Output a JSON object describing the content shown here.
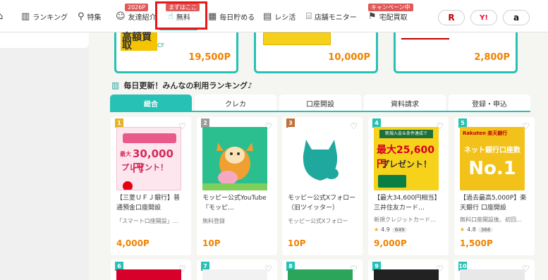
{
  "nav": {
    "items": [
      {
        "label": "ランキング",
        "icon": "ranking-icon"
      },
      {
        "label": "特集",
        "icon": "pin-icon"
      },
      {
        "label": "友達紹介",
        "icon": "friends-icon",
        "badge": "2026P"
      },
      {
        "label": "無料",
        "icon": "free-icon",
        "badge": "まずはここ"
      },
      {
        "label": "毎日貯める",
        "icon": "calendar-icon"
      },
      {
        "label": "レシ活",
        "icon": "receipt-icon"
      },
      {
        "label": "店舗モニター",
        "icon": "store-icon"
      },
      {
        "label": "宅配買取",
        "icon": "box-icon",
        "badge": "キャンペーン中"
      }
    ],
    "stores": [
      "R",
      "Y!",
      "a"
    ]
  },
  "offers": [
    {
      "points": "19,500P",
      "thumb_text": "高額買取"
    },
    {
      "points": "10,000P"
    },
    {
      "points": "2,800P"
    }
  ],
  "ranking": {
    "title": "毎日更新！みんなの利用ランキング♪",
    "tabs": [
      "総合",
      "クレカ",
      "口座開設",
      "資料請求",
      "登録・申込"
    ]
  },
  "cards": [
    {
      "rank": "1",
      "rank_color": "#e6b422",
      "name": "【三菱ＵＦＪ銀行】普通預金口座開設",
      "sub": "「スマート口座開設」…",
      "points": "4,000P",
      "thumb": {
        "bg": "#fde6ee",
        "line1": "最大",
        "line2": "30,000円",
        "line3": "プレゼント！"
      }
    },
    {
      "rank": "2",
      "rank_color": "#9b9b9b",
      "name": "モッピー公式YouTube『モッピ…",
      "sub": "無料登録",
      "points": "10P",
      "thumb": {
        "bg": "#2bbf8f"
      }
    },
    {
      "rank": "3",
      "rank_color": "#c0703a",
      "name": "モッピー公式Xフォロー（旧ツイッター）",
      "sub": "モッピー公式Xフォロー",
      "points": "10P",
      "thumb": {
        "bg": "#ffffff"
      }
    },
    {
      "rank": "4",
      "rank_color": "#27c1b5",
      "name": "【最大34,600円相当】三井住友カード…",
      "sub": "新規クレジットカード…",
      "rating": "4.9",
      "count": "649",
      "points": "9,000P",
      "thumb": {
        "bg": "#f7d21a",
        "line1": "新規入会＆条件達成で",
        "line2": "最大25,600円",
        "line3": "プレゼント！"
      }
    },
    {
      "rank": "5",
      "rank_color": "#27c1b5",
      "name": "【過去最高5,000P】楽天銀行 口座開設",
      "sub": "無料口座開設後、初回…",
      "rating": "4.8",
      "count": "366",
      "points": "1,500P",
      "thumb": {
        "bg": "#f2c21b",
        "line1": "Rakuten 楽天銀行",
        "line2": "ネット銀行口座数",
        "line3": "No.1"
      }
    }
  ],
  "cards_row2": [
    {
      "rank": "6",
      "rank_color": "#27c1b5"
    },
    {
      "rank": "7",
      "rank_color": "#27c1b5"
    },
    {
      "rank": "8",
      "rank_color": "#27c1b5"
    },
    {
      "rank": "9",
      "rank_color": "#27c1b5"
    },
    {
      "rank": "10",
      "rank_color": "#27c1b5"
    }
  ]
}
